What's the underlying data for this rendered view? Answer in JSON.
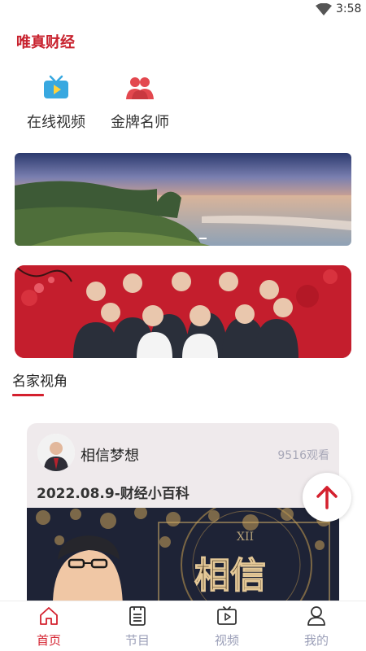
{
  "status_bar": {
    "time": "3:58",
    "wifi_icon": "wifi-icon"
  },
  "app": {
    "logo_text": "唯真财经"
  },
  "quick_links": [
    {
      "label": "在线视频",
      "icon": "tv-icon",
      "color": "#38a8e0"
    },
    {
      "label": "金牌名师",
      "icon": "users-icon",
      "color": "#e3484f"
    }
  ],
  "banner": {
    "active_slide": 1
  },
  "section": {
    "title": "名家视角"
  },
  "card": {
    "author": "相信梦想",
    "views": "9516观看",
    "title": "2022.08.9-财经小百科",
    "thumb_caption": "相信"
  },
  "tabbar": {
    "items": [
      {
        "label": "首页",
        "icon": "home-icon",
        "active": true
      },
      {
        "label": "节目",
        "icon": "list-icon",
        "active": false
      },
      {
        "label": "视频",
        "icon": "video-icon",
        "active": false
      },
      {
        "label": "我的",
        "icon": "user-icon",
        "active": false
      }
    ]
  },
  "colors": {
    "accent": "#d4202e",
    "inactive": "#9b9fb8"
  }
}
